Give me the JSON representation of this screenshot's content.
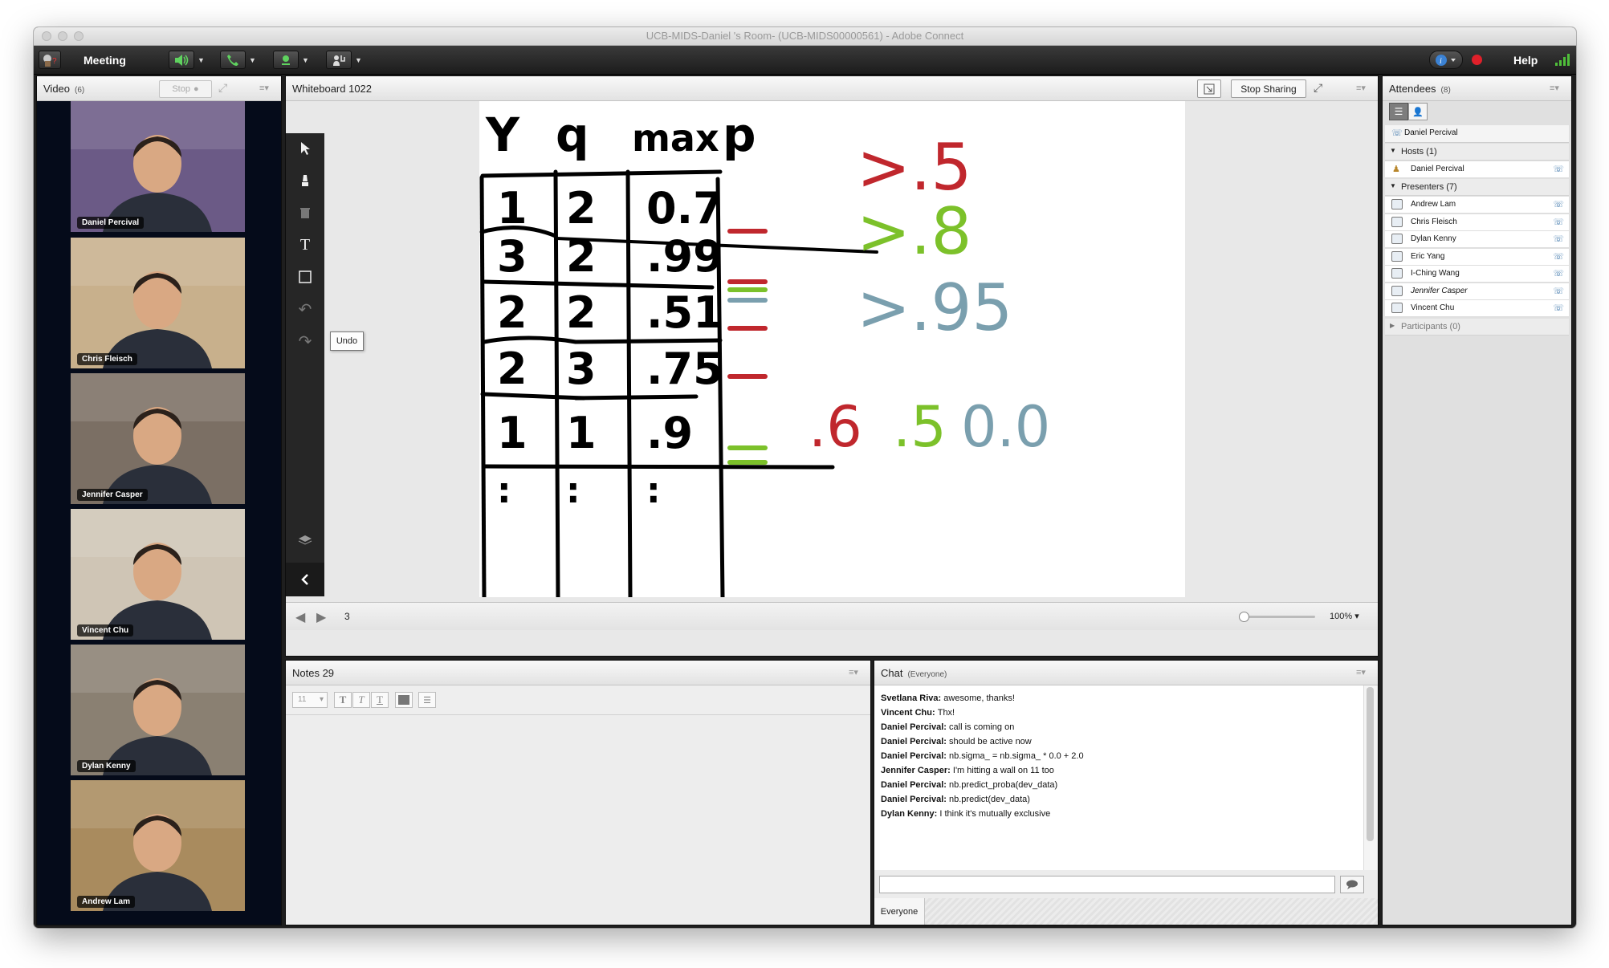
{
  "window": {
    "title": "UCB-MIDS-Daniel 's Room- (UCB-MIDS00000561) - Adobe Connect"
  },
  "menubar": {
    "meeting_label": "Meeting",
    "help_label": "Help"
  },
  "video": {
    "title": "Video",
    "count": "(6)",
    "stop_label": "Stop",
    "participants": [
      {
        "name": "Daniel Percival",
        "bg": "#6b5a86"
      },
      {
        "name": "Chris Fleisch",
        "bg": "#c8b08c"
      },
      {
        "name": "Jennifer Casper",
        "bg": "#7b6f64"
      },
      {
        "name": "Vincent Chu",
        "bg": "#cfc5b5"
      },
      {
        "name": "Dylan Kenny",
        "bg": "#8a8072"
      },
      {
        "name": "Andrew Lam",
        "bg": "#a98b5e"
      }
    ]
  },
  "whiteboard": {
    "title": "Whiteboard 1022",
    "stop_sharing_label": "Stop Sharing",
    "undo_tooltip": "Undo",
    "page_number": "3",
    "zoom": "100%",
    "headers": [
      "Y",
      "q",
      "max",
      "p"
    ],
    "rows": [
      [
        "1",
        "2",
        "0.7"
      ],
      [
        "3",
        "2",
        ".99"
      ],
      [
        "2",
        "2",
        ".51"
      ],
      [
        "2",
        "3",
        ".75"
      ],
      [
        "1",
        "1",
        ".9"
      ],
      [
        ":",
        ":",
        ":"
      ]
    ],
    "thresholds": [
      ">.5",
      ">.8",
      ">.95"
    ],
    "bottom_values": [
      ".6",
      ".5",
      "0.0"
    ],
    "colors": {
      "red": "#c0272d",
      "green": "#7cc12a",
      "blue": "#7a9fae"
    }
  },
  "notes": {
    "title": "Notes 29",
    "font_size": "11"
  },
  "chat": {
    "title": "Chat",
    "scope": "(Everyone)",
    "messages": [
      {
        "sender": "Svetlana Riva",
        "text": "awesome, thanks!"
      },
      {
        "sender": "Vincent Chu",
        "text": "Thx!"
      },
      {
        "sender": "Daniel Percival",
        "text": "call is coming on"
      },
      {
        "sender": "Daniel Percival",
        "text": "should be active now"
      },
      {
        "sender": "Daniel Percival",
        "text": "nb.sigma_ = nb.sigma_ * 0.0 + 2.0"
      },
      {
        "sender": "Jennifer Casper",
        "text": "I'm hitting a wall on 11 too"
      },
      {
        "sender": "Daniel Percival",
        "text": "nb.predict_proba(dev_data)"
      },
      {
        "sender": "Daniel Percival",
        "text": "nb.predict(dev_data)"
      },
      {
        "sender": "Dylan Kenny",
        "text": "I think it's mutually exclusive"
      }
    ],
    "recipient_tab": "Everyone"
  },
  "attendees": {
    "title": "Attendees",
    "count": "(8)",
    "me": "Daniel Percival",
    "hosts_label": "Hosts (1)",
    "hosts": [
      "Daniel Percival"
    ],
    "presenters_label": "Presenters (7)",
    "presenters": [
      "Andrew Lam",
      "Chris Fleisch",
      "Dylan Kenny",
      "Eric Yang",
      "I-Ching Wang",
      "Jennifer Casper",
      "Vincent Chu"
    ],
    "participants_label": "Participants (0)"
  }
}
